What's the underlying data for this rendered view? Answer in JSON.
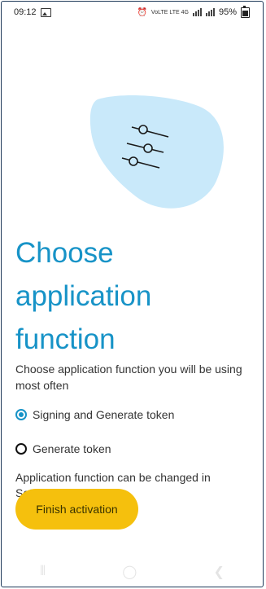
{
  "status_bar": {
    "time": "09:12",
    "net_label": "VoLTE LTE 4G",
    "battery": "95%"
  },
  "illustration": {
    "icon": "settings-sliders-icon"
  },
  "page": {
    "title_lines": [
      "Choose",
      "application",
      "function"
    ],
    "description": "Choose application function you will be using most often",
    "options": [
      {
        "label": "Signing and Generate token",
        "selected": true
      },
      {
        "label": "Generate token",
        "selected": false
      }
    ],
    "note": "Application function can be changed in Settings",
    "finish_label": "Finish activation"
  },
  "nav_bar": {
    "icons": [
      "recent-apps-icon",
      "home-icon",
      "back-icon"
    ]
  },
  "colors": {
    "accent": "#1793c7",
    "button": "#f5c00d",
    "blob": "#c9e9fa"
  }
}
